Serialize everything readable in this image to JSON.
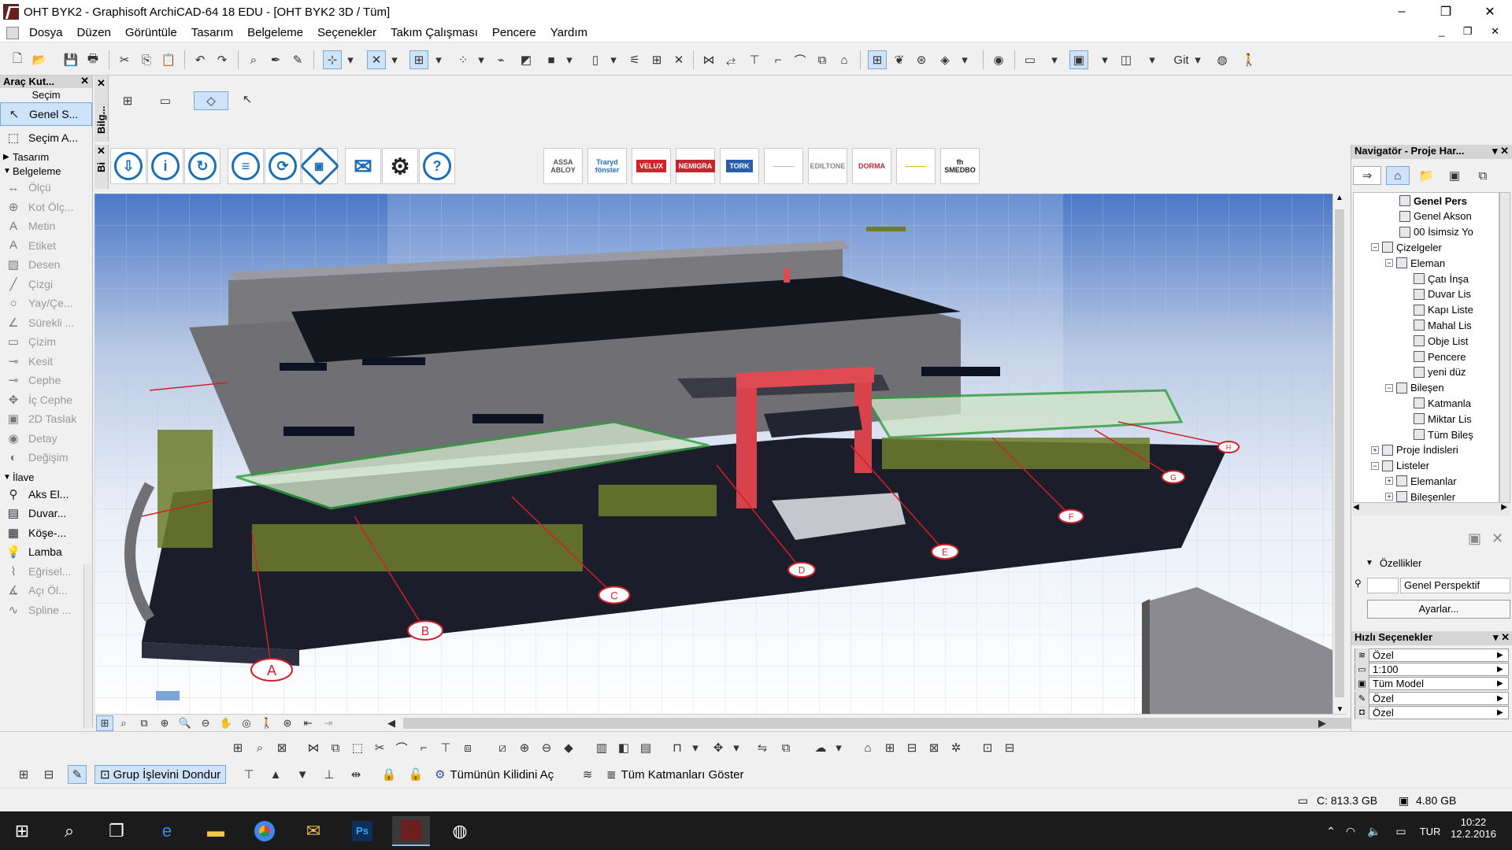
{
  "window": {
    "title": "OHT BYK2 - Graphisoft ArchiCAD-64 18 EDU - [OHT BYK2 3D / Tüm]",
    "min": "–",
    "max": "❐",
    "close": "✕"
  },
  "menu": [
    "Dosya",
    "Düzen",
    "Görüntüle",
    "Tasarım",
    "Belgeleme",
    "Seçenekler",
    "Takım Çalışması",
    "Pencere",
    "Yardım"
  ],
  "mdi_controls": "_ ❐ ✕",
  "toolbar": {
    "git_label": "Git"
  },
  "toolbox": {
    "title": "Araç Kut...",
    "section_select": "Seçim",
    "select_items": [
      {
        "label": "Genel S...",
        "icon": "arrow-icon"
      },
      {
        "label": "Seçim A...",
        "icon": "marquee-icon"
      }
    ],
    "section_design": "Tasarım",
    "section_doc": "Belgeleme",
    "doc_items": [
      {
        "label": "Ölçü",
        "glyph": "↔"
      },
      {
        "label": "Kot Ölç...",
        "glyph": "⊕"
      },
      {
        "label": "Metin",
        "glyph": "A"
      },
      {
        "label": "Etiket",
        "glyph": "A"
      },
      {
        "label": "Desen",
        "glyph": "▨"
      },
      {
        "label": "Çizgi",
        "glyph": "╱"
      },
      {
        "label": "Yay/Çe...",
        "glyph": "○"
      },
      {
        "label": "Sürekli ...",
        "glyph": "∠"
      },
      {
        "label": "Çizim",
        "glyph": "▭"
      },
      {
        "label": "Kesit",
        "glyph": "⊸"
      },
      {
        "label": "Cephe",
        "glyph": "⊸"
      },
      {
        "label": "İç Cephe",
        "glyph": "✥"
      },
      {
        "label": "2D Taslak",
        "glyph": "▣"
      },
      {
        "label": "Detay",
        "glyph": "◉"
      },
      {
        "label": "Değişim",
        "glyph": "◐"
      }
    ],
    "section_more": "İlave",
    "more_items": [
      {
        "label": "Aks El...",
        "glyph": "⚲",
        "enabled": true
      },
      {
        "label": "Duvar...",
        "glyph": "▤",
        "enabled": true
      },
      {
        "label": "Köşe-...",
        "glyph": "▦",
        "enabled": true
      },
      {
        "label": "Lamba",
        "glyph": "💡",
        "enabled": true
      },
      {
        "label": "Eğrisel...",
        "glyph": "⌇",
        "enabled": false
      },
      {
        "label": "Açı Öl...",
        "glyph": "∡",
        "enabled": false
      },
      {
        "label": "Spline ...",
        "glyph": "∿",
        "enabled": false
      }
    ]
  },
  "info_tab": "Bilg...",
  "toolbar2_tab": "Bi",
  "toolbar2_buttons": [
    "download-cloud-icon",
    "info-icon",
    "refresh-icon",
    "cloud-list-icon",
    "cloud-sync-icon",
    "network-icon",
    "mail-icon",
    "settings-icon",
    "help-icon"
  ],
  "brands": [
    {
      "label": "ASSA ABLOY",
      "color": "#555"
    },
    {
      "label": "Traryd fönster",
      "color": "#1c6fb3"
    },
    {
      "label": "VELUX",
      "color": "#fff",
      "bg": "#d2232a"
    },
    {
      "label": "NEMIGRA",
      "color": "#fff",
      "bg": "#c1272d"
    },
    {
      "label": "TORK",
      "color": "#fff",
      "bg": "#2a5ea8"
    },
    {
      "label": "———",
      "color": "#bbb"
    },
    {
      "label": "EDILTONE",
      "color": "#888"
    },
    {
      "label": "DORMA",
      "color": "#c1272d"
    },
    {
      "label": "———",
      "color": "#e5b200"
    },
    {
      "label": "fh SMEDBO",
      "color": "#222"
    }
  ],
  "grid_labels": [
    "A",
    "B",
    "C",
    "D",
    "E",
    "F",
    "G",
    "H"
  ],
  "navigator": {
    "title": "Navigatör - Proje Har...",
    "tree": [
      {
        "label": "Genel Pers",
        "depth": 3,
        "bold": true,
        "expander": ""
      },
      {
        "label": "Genel Akson",
        "depth": 3,
        "bold": false,
        "expander": ""
      },
      {
        "label": "00 İsimsiz Yo",
        "depth": 3,
        "bold": false,
        "expander": ""
      },
      {
        "label": "Çizelgeler",
        "depth": 1,
        "bold": false,
        "expander": "−"
      },
      {
        "label": "Eleman",
        "depth": 2,
        "bold": false,
        "expander": "−"
      },
      {
        "label": "Çatı İnşa",
        "depth": 4,
        "bold": false,
        "expander": ""
      },
      {
        "label": "Duvar Lis",
        "depth": 4,
        "bold": false,
        "expander": ""
      },
      {
        "label": "Kapı Liste",
        "depth": 4,
        "bold": false,
        "expander": ""
      },
      {
        "label": "Mahal Lis",
        "depth": 4,
        "bold": false,
        "expander": ""
      },
      {
        "label": "Obje List",
        "depth": 4,
        "bold": false,
        "expander": ""
      },
      {
        "label": "Pencere",
        "depth": 4,
        "bold": false,
        "expander": ""
      },
      {
        "label": "yeni düz",
        "depth": 4,
        "bold": false,
        "expander": ""
      },
      {
        "label": "Bileşen",
        "depth": 2,
        "bold": false,
        "expander": "−"
      },
      {
        "label": "Katmanla",
        "depth": 4,
        "bold": false,
        "expander": ""
      },
      {
        "label": "Miktar Lis",
        "depth": 4,
        "bold": false,
        "expander": ""
      },
      {
        "label": "Tüm Bileş",
        "depth": 4,
        "bold": false,
        "expander": ""
      },
      {
        "label": "Proje İndisleri",
        "depth": 1,
        "bold": false,
        "expander": "+"
      },
      {
        "label": "Listeler",
        "depth": 1,
        "bold": false,
        "expander": "−"
      },
      {
        "label": "Elemanlar",
        "depth": 2,
        "bold": false,
        "expander": "+"
      },
      {
        "label": "Bileşenler",
        "depth": 2,
        "bold": false,
        "expander": "+"
      }
    ],
    "properties_label": "Özellikler",
    "properties_value": "Genel Perspektif",
    "settings_button": "Ayarlar..."
  },
  "quick_options": {
    "title": "Hızlı Seçenekler",
    "items": [
      {
        "icon": "layer-icon",
        "glyph": "≋",
        "value": "Özel"
      },
      {
        "icon": "scale-icon",
        "glyph": "▭",
        "value": "1:100"
      },
      {
        "icon": "model-view-icon",
        "glyph": "▣",
        "value": "Tüm Model"
      },
      {
        "icon": "pen-set-icon",
        "glyph": "✎",
        "value": "Özel"
      },
      {
        "icon": "dimension-icon",
        "glyph": "◘",
        "value": "Özel"
      }
    ]
  },
  "bottom": {
    "freeze_group": "Grup İşlevini Dondur",
    "unlock_all": "Tümünün Kilidini Aç",
    "show_layers": "Tüm Katmanları Göster"
  },
  "status": {
    "disk": "C: 813.3 GB",
    "ram": "4.80 GB"
  },
  "taskbar": {
    "time": "10:22",
    "date": "12.2.2016",
    "lang": "TUR"
  }
}
